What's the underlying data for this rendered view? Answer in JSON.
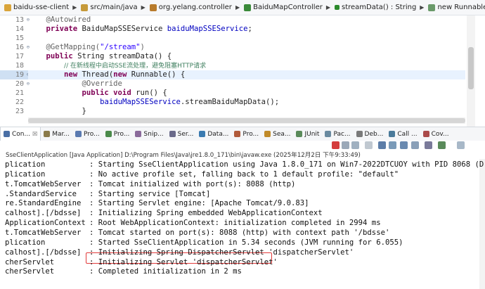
{
  "breadcrumb": [
    {
      "label": "baidu-sse-client",
      "icon": "project-icon"
    },
    {
      "label": "src/main/java",
      "icon": "source-folder-icon"
    },
    {
      "label": "org.yelang.controller",
      "icon": "package-icon"
    },
    {
      "label": "BaiduMapController",
      "icon": "class-icon"
    },
    {
      "label": "streamData() : String",
      "icon": "method-icon"
    },
    {
      "label": "new Runnable() {...}",
      "icon": "runnable-icon"
    }
  ],
  "editor": {
    "lines": [
      {
        "n": "13",
        "fold": "⊖",
        "segs": [
          {
            "c": "ann",
            "t": "    @Autowired"
          }
        ]
      },
      {
        "n": "14",
        "segs": [
          {
            "c": "kw",
            "t": "    private "
          },
          {
            "c": "",
            "t": "BaiduMapSSEService "
          },
          {
            "c": "fld",
            "t": "baiduMapSSEService"
          },
          {
            "c": "",
            "t": ";"
          }
        ]
      },
      {
        "n": "15",
        "segs": []
      },
      {
        "n": "16",
        "fold": "⊖",
        "segs": [
          {
            "c": "ann",
            "t": "    @GetMapping("
          },
          {
            "c": "str",
            "t": "\"/stream\""
          },
          {
            "c": "ann",
            "t": ")"
          }
        ]
      },
      {
        "n": "17",
        "segs": [
          {
            "c": "kw",
            "t": "    public "
          },
          {
            "c": "",
            "t": "String streamData() {"
          }
        ]
      },
      {
        "n": "18",
        "segs": [
          {
            "c": "",
            "t": "        "
          },
          {
            "c": "cmt",
            "t": "// 在新线程中启动SSE流处理，避免阻塞HTTP请求"
          }
        ]
      },
      {
        "n": "19",
        "fold": "⊖",
        "active": true,
        "segs": [
          {
            "c": "",
            "t": "        "
          },
          {
            "c": "kw",
            "t": "new "
          },
          {
            "c": "",
            "t": "Thread("
          },
          {
            "c": "kw",
            "t": "new "
          },
          {
            "c": "",
            "t": "Runnable() {"
          }
        ]
      },
      {
        "n": "20",
        "fold": "⊖",
        "segs": [
          {
            "c": "ann",
            "t": "            @Override"
          }
        ]
      },
      {
        "n": "21",
        "segs": [
          {
            "c": "kw",
            "t": "            public void "
          },
          {
            "c": "",
            "t": "run() {"
          }
        ]
      },
      {
        "n": "22",
        "segs": [
          {
            "c": "",
            "t": "                "
          },
          {
            "c": "fld",
            "t": "baiduMapSSEService"
          },
          {
            "c": "",
            "t": ".streamBaiduMapData();"
          }
        ]
      },
      {
        "n": "23",
        "segs": [
          {
            "c": "",
            "t": "            }"
          }
        ]
      }
    ]
  },
  "tabs": [
    {
      "label": "Con...",
      "active": true,
      "extra": "☒",
      "color": "#4a6fa5"
    },
    {
      "label": "Mar...",
      "color": "#8a7a4a"
    },
    {
      "label": "Pro...",
      "color": "#5a7ab0"
    },
    {
      "label": "Pro...",
      "color": "#4a8a4a"
    },
    {
      "label": "Snip...",
      "color": "#8a6a9a"
    },
    {
      "label": "Ser...",
      "color": "#6a6a8a"
    },
    {
      "label": "Data...",
      "color": "#3a7ab0"
    },
    {
      "label": "Pro...",
      "color": "#b05a3a"
    },
    {
      "label": "Sea...",
      "color": "#c08a2a"
    },
    {
      "label": "JUnit",
      "color": "#5a8a5a",
      "prefix": "Ju"
    },
    {
      "label": "Pac...",
      "color": "#6a8aa0"
    },
    {
      "label": "Deb...",
      "color": "#7a7a7a"
    },
    {
      "label": "Call ...",
      "color": "#4a7a9a"
    },
    {
      "label": "Cov...",
      "color": "#aa4a4a"
    }
  ],
  "console": {
    "header": "SseClientApplication [Java Application] D:\\Program Files\\Java\\jre1.8.0_171\\bin\\javaw.exe (2025年12月2日 下午9:33:49)",
    "lines": [
      {
        "src": "plication",
        "msg": ": Starting SseClientApplication using Java 1.8.0_171 on Win7-2022DTCUOY with PID 8068 (D"
      },
      {
        "src": "plication",
        "msg": ": No active profile set, falling back to 1 default profile: \"default\""
      },
      {
        "src": "t.TomcatWebServer",
        "msg": ": Tomcat initialized with port(s): 8088 (http)"
      },
      {
        "src": ".StandardService",
        "msg": ": Starting service [Tomcat]"
      },
      {
        "src": "re.StandardEngine",
        "msg": ": Starting Servlet engine: [Apache Tomcat/9.0.83]"
      },
      {
        "src": "calhost].[/bdsse]",
        "msg": ": Initializing Spring embedded WebApplicationContext"
      },
      {
        "src": "ApplicationContext",
        "msg": ": Root WebApplicationContext: initialization completed in 2994 ms"
      },
      {
        "src": "t.TomcatWebServer",
        "msg": ": Tomcat started on port(s): 8088 (http) with context path '/bdsse'"
      },
      {
        "src": "plication",
        "msg": ": Started SseClientApplication in 5.34 seconds (JVM running for 6.055)"
      },
      {
        "src": "calhost].[/bdsse]",
        "msg": ": Initializing Spring DispatcherServlet 'dispatcherServlet'"
      },
      {
        "src": "cherServlet",
        "msg": ": Initializing Servlet 'dispatcherServlet'"
      },
      {
        "src": "cherServlet",
        "msg": ": Completed initialization in 2 ms"
      }
    ]
  },
  "colors": {
    "highlight": "#e23b3b",
    "keyword": "#7f0055",
    "string": "#2a00ff",
    "field": "#0000c0"
  }
}
